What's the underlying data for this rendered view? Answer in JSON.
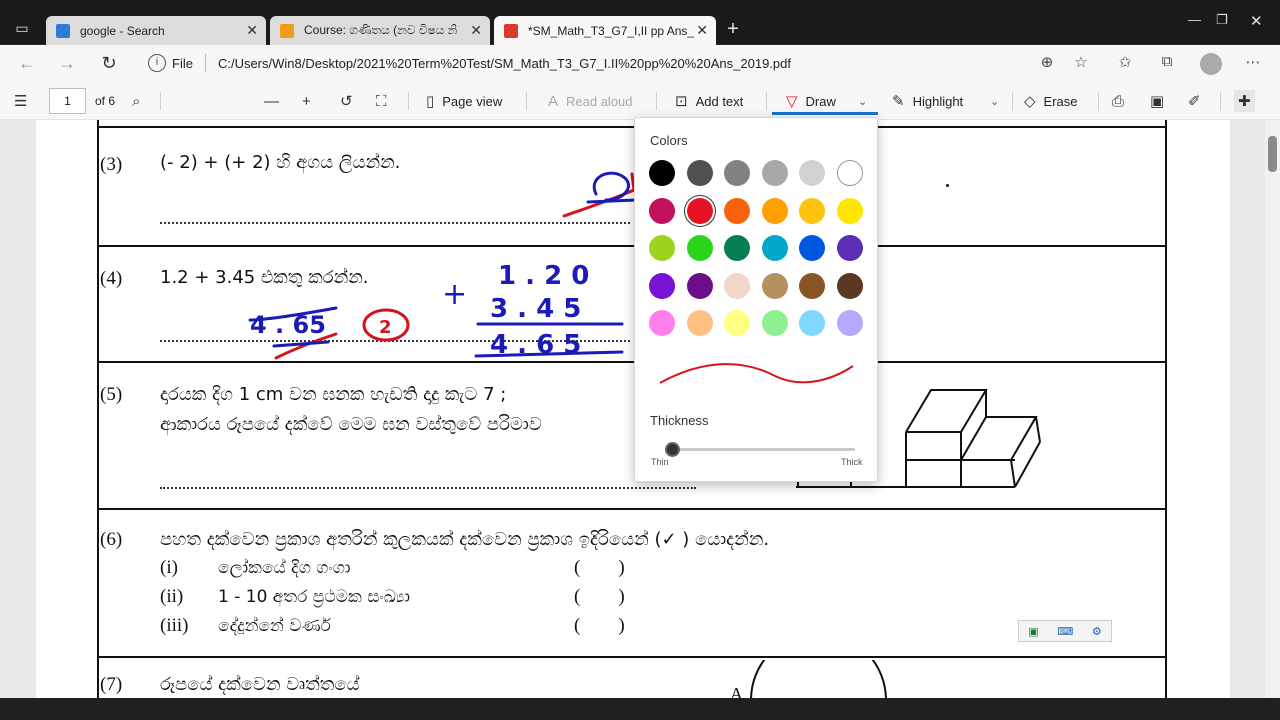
{
  "browser": {
    "tabs": [
      {
        "label": "google - Search",
        "icon": "bing-icon",
        "active": false
      },
      {
        "label": "Course: ගණිතය (නව විෂය නි",
        "icon": "moodle-icon",
        "active": false
      },
      {
        "label": "*SM_Math_T3_G7_I,II pp Ans_20",
        "icon": "pdf-icon",
        "active": true
      }
    ],
    "address_scheme": "File",
    "address": "C:/Users/Win8/Desktop/2021%20Term%20Test/SM_Math_T3_G7_I.II%20pp%20%20Ans_2019.pdf"
  },
  "pdf_toolbar": {
    "page_number": "1",
    "page_total": "of 6",
    "page_view": "Page view",
    "read_aloud": "Read aloud",
    "add_text": "Add text",
    "draw": "Draw",
    "highlight": "Highlight",
    "erase": "Erase"
  },
  "draw_panel": {
    "colors_label": "Colors",
    "thickness_label": "Thickness",
    "thin_label": "Thin",
    "thick_label": "Thick",
    "thickness_value": 0.03,
    "selected_color": "#e81123",
    "colors": [
      "#000000",
      "#505050",
      "#828282",
      "#a8a8a8",
      "#d2d2d2",
      "#ffffff",
      "#c3105f",
      "#e81123",
      "#f7630c",
      "#ffa000",
      "#ffc40d",
      "#ffe600",
      "#9bd41a",
      "#2bd41a",
      "#067e4f",
      "#00a7c9",
      "#0058e0",
      "#5c2eb8",
      "#7a12d4",
      "#6b0f8a",
      "#f2d7c9",
      "#b59160",
      "#8a5525",
      "#5a3823",
      "#ff80ec",
      "#ffc083",
      "#ffff80",
      "#8ef08e",
      "#80d8ff",
      "#b4a8ff"
    ]
  },
  "document": {
    "q3": {
      "num": "(3)",
      "text": "(- 2)  +  (+ 2) හි අගය ලියන්න."
    },
    "q4": {
      "num": "(4)",
      "text": "1.2  +  3.45 එකතු කරන්න."
    },
    "q5": {
      "num": "(5)",
      "line1": "දාරයක දිග 1 cm වන ඝනක හැඩති දාදු කැට 7 ;",
      "line2": "ආකාරය රූපයේ දක්වේ මෙම ඝන වස්තුවේ පරිමාව"
    },
    "q6": {
      "num": "(6)",
      "text": "පහත දක්වෙන ප්‍රකාශ අතරින් කුලකයක් දක්වෙන ප්‍රකාශ ඉදිරියෙන් (✓ ) යොදන්න.",
      "items": [
        {
          "roman": "(i)",
          "text": "ලෝකයේ දිග ගංගා",
          "box": "(        )"
        },
        {
          "roman": "(ii)",
          "text": "1 - 10 අතර ප්‍රථමක සංඛ්‍යා",
          "box": "(        )"
        },
        {
          "roman": "(iii)",
          "text": "දේදුන්නේ වර්ණ",
          "box": "(        )"
        }
      ]
    },
    "q7": {
      "num": "(7)",
      "text": "රූපයේ දක්වෙන වෘත්තයේ"
    }
  },
  "annotations": {
    "q3_answer": "0",
    "q4_sum_top": "1 . 2 0",
    "q4_sum_mid": "3 . 4 5",
    "q4_sum_res": "4 . 6 5",
    "q4_plus": "+",
    "q4_written": "4 . 65",
    "q4_mark": "2"
  }
}
